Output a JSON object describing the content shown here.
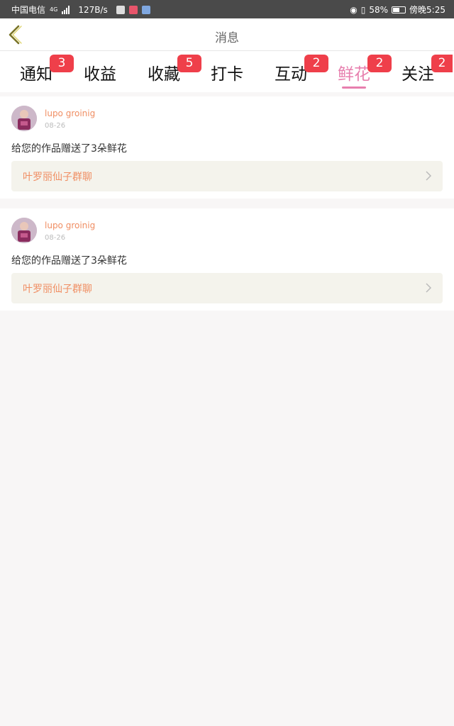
{
  "status_bar": {
    "carrier": "中国电信",
    "network_type": "4G",
    "speed": "127B/s",
    "battery": "58%",
    "battery_level": 0.58,
    "time": "傍晚5:25"
  },
  "header": {
    "title": "消息",
    "back_icon": "chevron-left-icon"
  },
  "tabs": [
    {
      "label": "通知",
      "badge": "3"
    },
    {
      "label": "收益",
      "badge": ""
    },
    {
      "label": "收藏",
      "badge": "5"
    },
    {
      "label": "打卡",
      "badge": ""
    },
    {
      "label": "互动",
      "badge": "2"
    },
    {
      "label": "鲜花",
      "badge": "2",
      "active": true
    },
    {
      "label": "关注",
      "badge": "2"
    }
  ],
  "messages": [
    {
      "user": "lupo groinig",
      "date": "08-26",
      "text": "给您的作品赠送了3朵鲜花",
      "link": "叶罗丽仙子群聊"
    },
    {
      "user": "lupo groinig",
      "date": "08-26",
      "text": "给您的作品赠送了3朵鲜花",
      "link": "叶罗丽仙子群聊"
    }
  ],
  "colors": {
    "accent": "#e77fae",
    "badge": "#ef3f4a",
    "username": "#f08e63",
    "status_bar": "#4a4a4a"
  }
}
